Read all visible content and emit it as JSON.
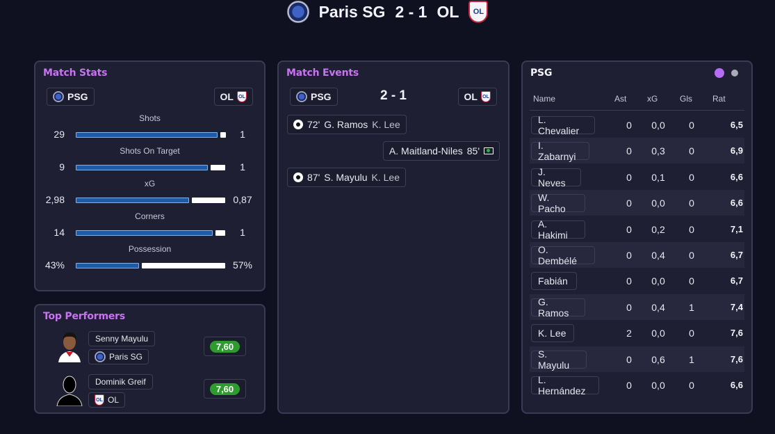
{
  "header": {
    "home_team": "Paris SG",
    "score": "2 - 1",
    "away_team": "OL"
  },
  "match_stats": {
    "title": "Match Stats",
    "home_abbr": "PSG",
    "away_abbr": "OL",
    "rows": [
      {
        "label": "Shots",
        "home": "29",
        "away": "1",
        "home_share": 0.967
      },
      {
        "label": "Shots On Target",
        "home": "9",
        "away": "1",
        "home_share": 0.9
      },
      {
        "label": "xG",
        "home": "2,98",
        "away": "0,87",
        "home_share": 0.774
      },
      {
        "label": "Corners",
        "home": "14",
        "away": "1",
        "home_share": 0.933
      },
      {
        "label": "Possession",
        "home": "43%",
        "away": "57%",
        "home_share": 0.43
      }
    ]
  },
  "top_performers": {
    "title": "Top Performers",
    "players": [
      {
        "name": "Senny Mayulu",
        "team": "Paris SG",
        "rating": "7,60"
      },
      {
        "name": "Dominik Greif",
        "team": "OL",
        "rating": "7,60"
      }
    ]
  },
  "match_events": {
    "title": "Match Events",
    "home_abbr": "PSG",
    "away_abbr": "OL",
    "score": "2 - 1",
    "events": [
      {
        "side": "home",
        "type": "goal",
        "minute": "72'",
        "player": "G. Ramos",
        "assist": "K. Lee"
      },
      {
        "side": "away",
        "type": "substitution",
        "minute": "85'",
        "player": "A. Maitland-Niles"
      },
      {
        "side": "home",
        "type": "goal",
        "minute": "87'",
        "player": "S. Mayulu",
        "assist": "K. Lee"
      }
    ]
  },
  "player_table": {
    "team": "PSG",
    "toggle_colors": [
      "#b76cf5",
      "#a9abb8"
    ],
    "columns": [
      "Name",
      "Ast",
      "xG",
      "Gls",
      "Rat"
    ],
    "rows": [
      {
        "name": "L. Chevalier",
        "ast": "0",
        "xg": "0,0",
        "gls": "0",
        "rat": "6,5"
      },
      {
        "name": "I. Zabarnyi",
        "ast": "0",
        "xg": "0,3",
        "gls": "0",
        "rat": "6,9"
      },
      {
        "name": "J. Neves",
        "ast": "0",
        "xg": "0,1",
        "gls": "0",
        "rat": "6,6"
      },
      {
        "name": "W. Pacho",
        "ast": "0",
        "xg": "0,0",
        "gls": "0",
        "rat": "6,6"
      },
      {
        "name": "A. Hakimi",
        "ast": "0",
        "xg": "0,2",
        "gls": "0",
        "rat": "7,1"
      },
      {
        "name": "O. Dembélé",
        "ast": "0",
        "xg": "0,4",
        "gls": "0",
        "rat": "6,7"
      },
      {
        "name": "Fabián",
        "ast": "0",
        "xg": "0,0",
        "gls": "0",
        "rat": "6,7"
      },
      {
        "name": "G. Ramos",
        "ast": "0",
        "xg": "0,4",
        "gls": "1",
        "rat": "7,4"
      },
      {
        "name": "K. Lee",
        "ast": "2",
        "xg": "0,0",
        "gls": "0",
        "rat": "7,6"
      },
      {
        "name": "S. Mayulu",
        "ast": "0",
        "xg": "0,6",
        "gls": "1",
        "rat": "7,6"
      },
      {
        "name": "L. Hernández",
        "ast": "0",
        "xg": "0,0",
        "gls": "0",
        "rat": "6,6"
      }
    ]
  }
}
